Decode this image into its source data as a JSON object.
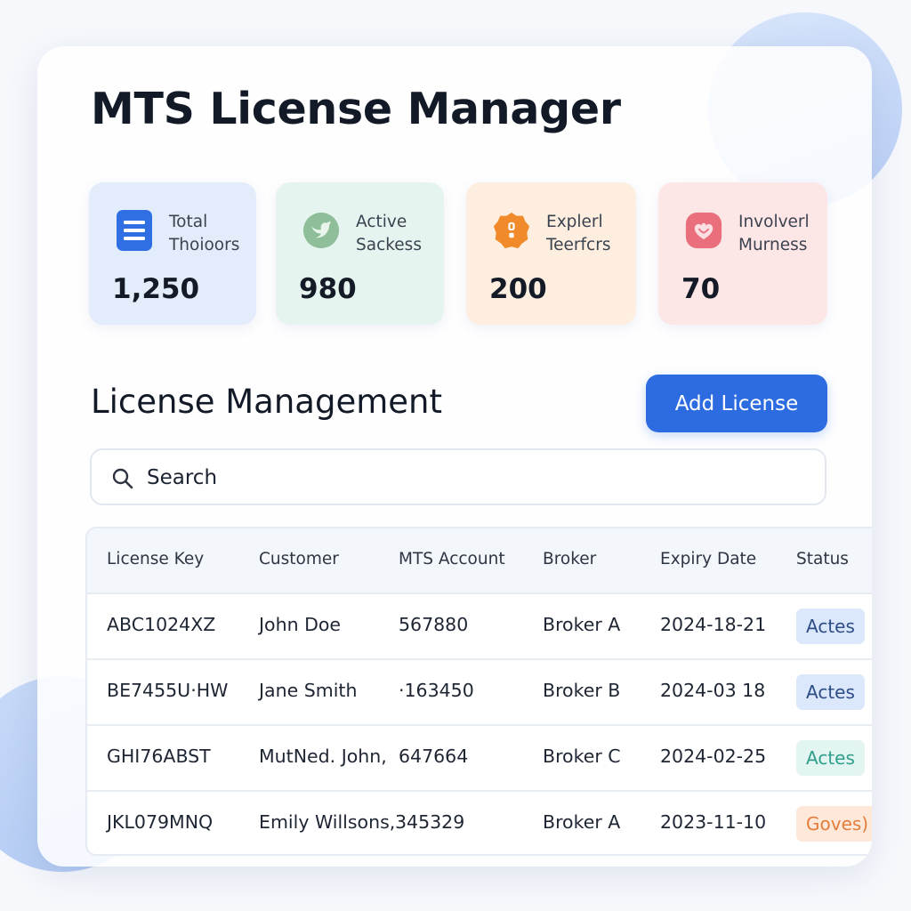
{
  "app": {
    "title": "MTS License Manager"
  },
  "stats": [
    {
      "label_line1": "Total",
      "label_line2": "Thoioors",
      "value": "1,250",
      "icon": "document-list-icon",
      "bg": "#e3ecfb",
      "accent": "#2f6fe3"
    },
    {
      "label_line1": "Active",
      "label_line2": "Sackess",
      "value": "980",
      "icon": "bird-icon",
      "bg": "#e6f4ef",
      "accent": "#7fb48e"
    },
    {
      "label_line1": "Explerl",
      "label_line2": "Teerfcrs",
      "value": "200",
      "icon": "alert-badge-icon",
      "bg": "#fdeedf",
      "accent": "#f08a2a"
    },
    {
      "label_line1": "Involverl",
      "label_line2": "Murness",
      "value": "70",
      "icon": "heart-flower-icon",
      "bg": "#fde6e6",
      "accent": "#ea6f7d"
    }
  ],
  "section": {
    "title": "License Management",
    "add_button_label": "Add License"
  },
  "search": {
    "placeholder": "Search",
    "value": ""
  },
  "table": {
    "columns": [
      "License Key",
      "Customer",
      "MTS Account",
      "Broker",
      "Expiry Date",
      "Status"
    ],
    "rows": [
      {
        "license_key": "ABC1024XZ",
        "customer": "John Doe",
        "mts_account": "567880",
        "broker": "Broker A",
        "expiry_date": "2024-18-21",
        "status": "Actes",
        "status_color": "blue"
      },
      {
        "license_key": "BE7455U·HW",
        "customer": "Jane Smith",
        "mts_account": "·163450",
        "broker": "Broker B",
        "expiry_date": "2024-03 18",
        "status": "Actes",
        "status_color": "blue"
      },
      {
        "license_key": "GHI76ABST",
        "customer": "MutNed. John,",
        "mts_account": "647664",
        "broker": "Broker C",
        "expiry_date": "2024-02-25",
        "status": "Actes",
        "status_color": "green"
      },
      {
        "license_key": "JKL079MNQ",
        "customer": "Emily Willsons,",
        "mts_account": "345329",
        "broker": "Broker A",
        "expiry_date": "2023-11-10",
        "status": "Goves)",
        "status_color": "orange"
      }
    ]
  },
  "colors": {
    "accent": "#2c6be0",
    "badge_blue": "#dbe7fb",
    "badge_green": "#e2f5f1",
    "badge_orange": "#fde8da"
  }
}
